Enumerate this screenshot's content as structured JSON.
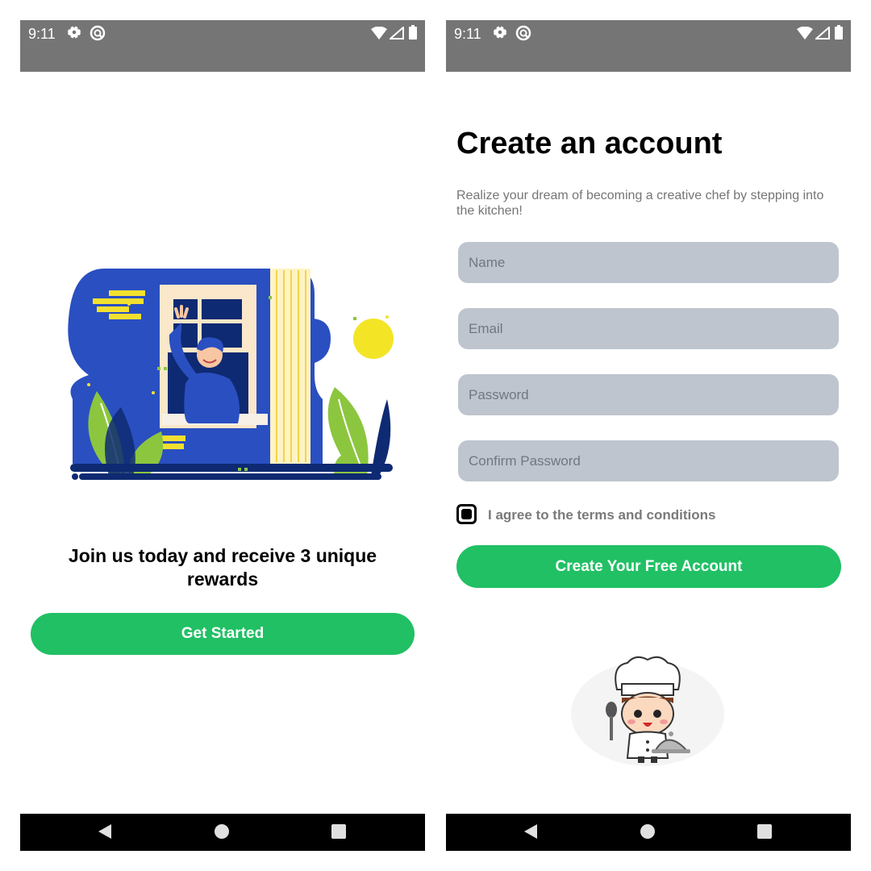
{
  "status_bar": {
    "time": "9:11"
  },
  "onboarding": {
    "promo_text": "Join us today and receive 3 unique rewards",
    "get_started_label": "Get Started"
  },
  "signup": {
    "title": "Create an account",
    "subtitle": "Realize your dream of becoming a creative chef by stepping into the kitchen!",
    "fields": {
      "name_placeholder": "Name",
      "email_placeholder": "Email",
      "password_placeholder": "Password",
      "confirm_placeholder": "Confirm Password"
    },
    "terms_label": "I agree to the terms and conditions",
    "terms_checked": true,
    "create_button_label": "Create Your Free Account"
  },
  "icons": {
    "status": [
      "gear-icon",
      "dnd-icon",
      "wifi-icon",
      "signal-icon",
      "battery-icon"
    ],
    "nav": [
      "back-icon",
      "home-icon",
      "recent-apps-icon"
    ]
  },
  "colors": {
    "accent_green": "#21c064",
    "status_bar": "#757575",
    "field_bg": "#bec5ce",
    "nav_bar": "#000000",
    "illustration_blue": "#2a4fc1"
  }
}
